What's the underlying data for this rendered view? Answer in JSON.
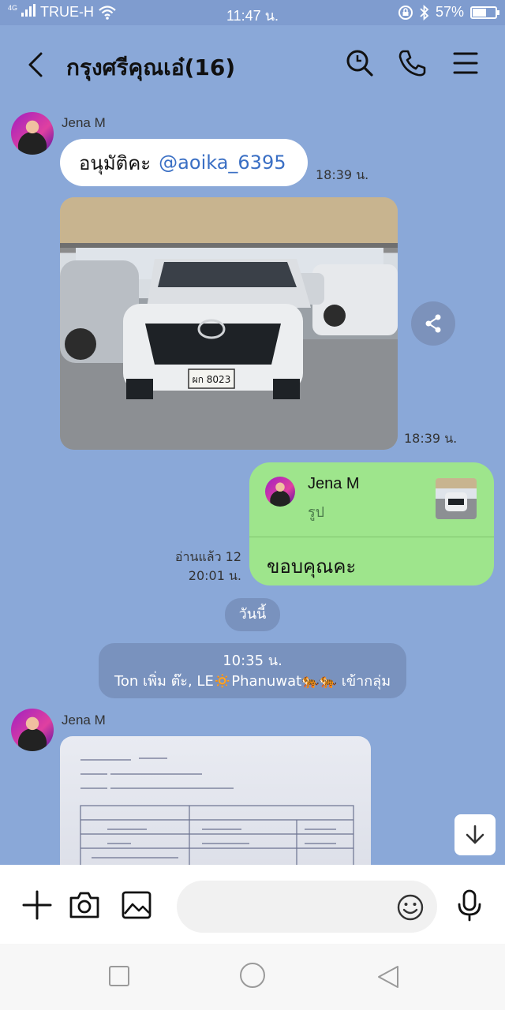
{
  "status": {
    "network": "4G",
    "carrier": "TRUE-H",
    "time": "11:47 น.",
    "battery": "57%",
    "battery_level": 0.57
  },
  "header": {
    "title": "กรุงศรีคุณเอ๋(16)",
    "icons": [
      "back-icon",
      "search-icon",
      "phone-icon",
      "menu-icon"
    ]
  },
  "messages": {
    "m1": {
      "sender": "Jena M",
      "text": "อนุมัติคะ",
      "mention": "@aoika_6395",
      "time": "18:39 น."
    },
    "m2": {
      "time": "18:39 น.",
      "plate": "ผก 8023"
    },
    "m3": {
      "reply_sender": "Jena M",
      "reply_type": "รูป",
      "text": "ขอบคุณคะ",
      "read": "อ่านแล้ว 12",
      "time": "20:01 น."
    },
    "date_divider": "วันนี้",
    "system": {
      "time": "10:35 น.",
      "text": "Ton เพิ่ม ต๊ะ, LE🔅Phanuwat🐅🐅 เข้ากลุ่ม"
    },
    "m4": {
      "sender": "Jena M"
    }
  },
  "input": {
    "placeholder": ""
  },
  "colors": {
    "chat_bg": "#8aa8d8",
    "bubble_green": "#9ee58c",
    "mention": "#3a6fc4"
  }
}
